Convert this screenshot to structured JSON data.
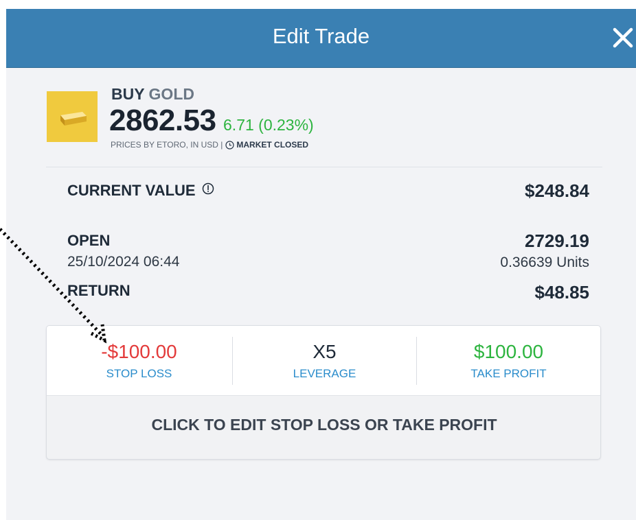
{
  "header": {
    "title": "Edit Trade"
  },
  "asset": {
    "action": "BUY",
    "name": "GOLD",
    "price": "2862.53",
    "change": "6.71 (0.23%)",
    "source": "PRICES BY ETORO, IN USD |",
    "market_status": "MARKET CLOSED",
    "icon": "gold-bar-icon"
  },
  "position": {
    "current_value_label": "CURRENT VALUE",
    "current_value": "$248.84",
    "open_label": "OPEN",
    "open_datetime": "25/10/2024 06:44",
    "open_rate": "2729.19",
    "units": "0.36639 Units",
    "return_label": "RETURN",
    "return_value": "$48.85"
  },
  "risk": {
    "stop_loss_value": "-$100.00",
    "stop_loss_label": "STOP LOSS",
    "leverage_value": "X5",
    "leverage_label": "LEVERAGE",
    "take_profit_value": "$100.00",
    "take_profit_label": "TAKE PROFIT",
    "edit_button": "CLICK TO EDIT STOP LOSS OR TAKE PROFIT"
  },
  "colors": {
    "header": "#3a80b3",
    "loss": "#e33a3a",
    "profit": "#2db43f",
    "link": "#2a8ccb",
    "gold": "#f0ca3e"
  }
}
